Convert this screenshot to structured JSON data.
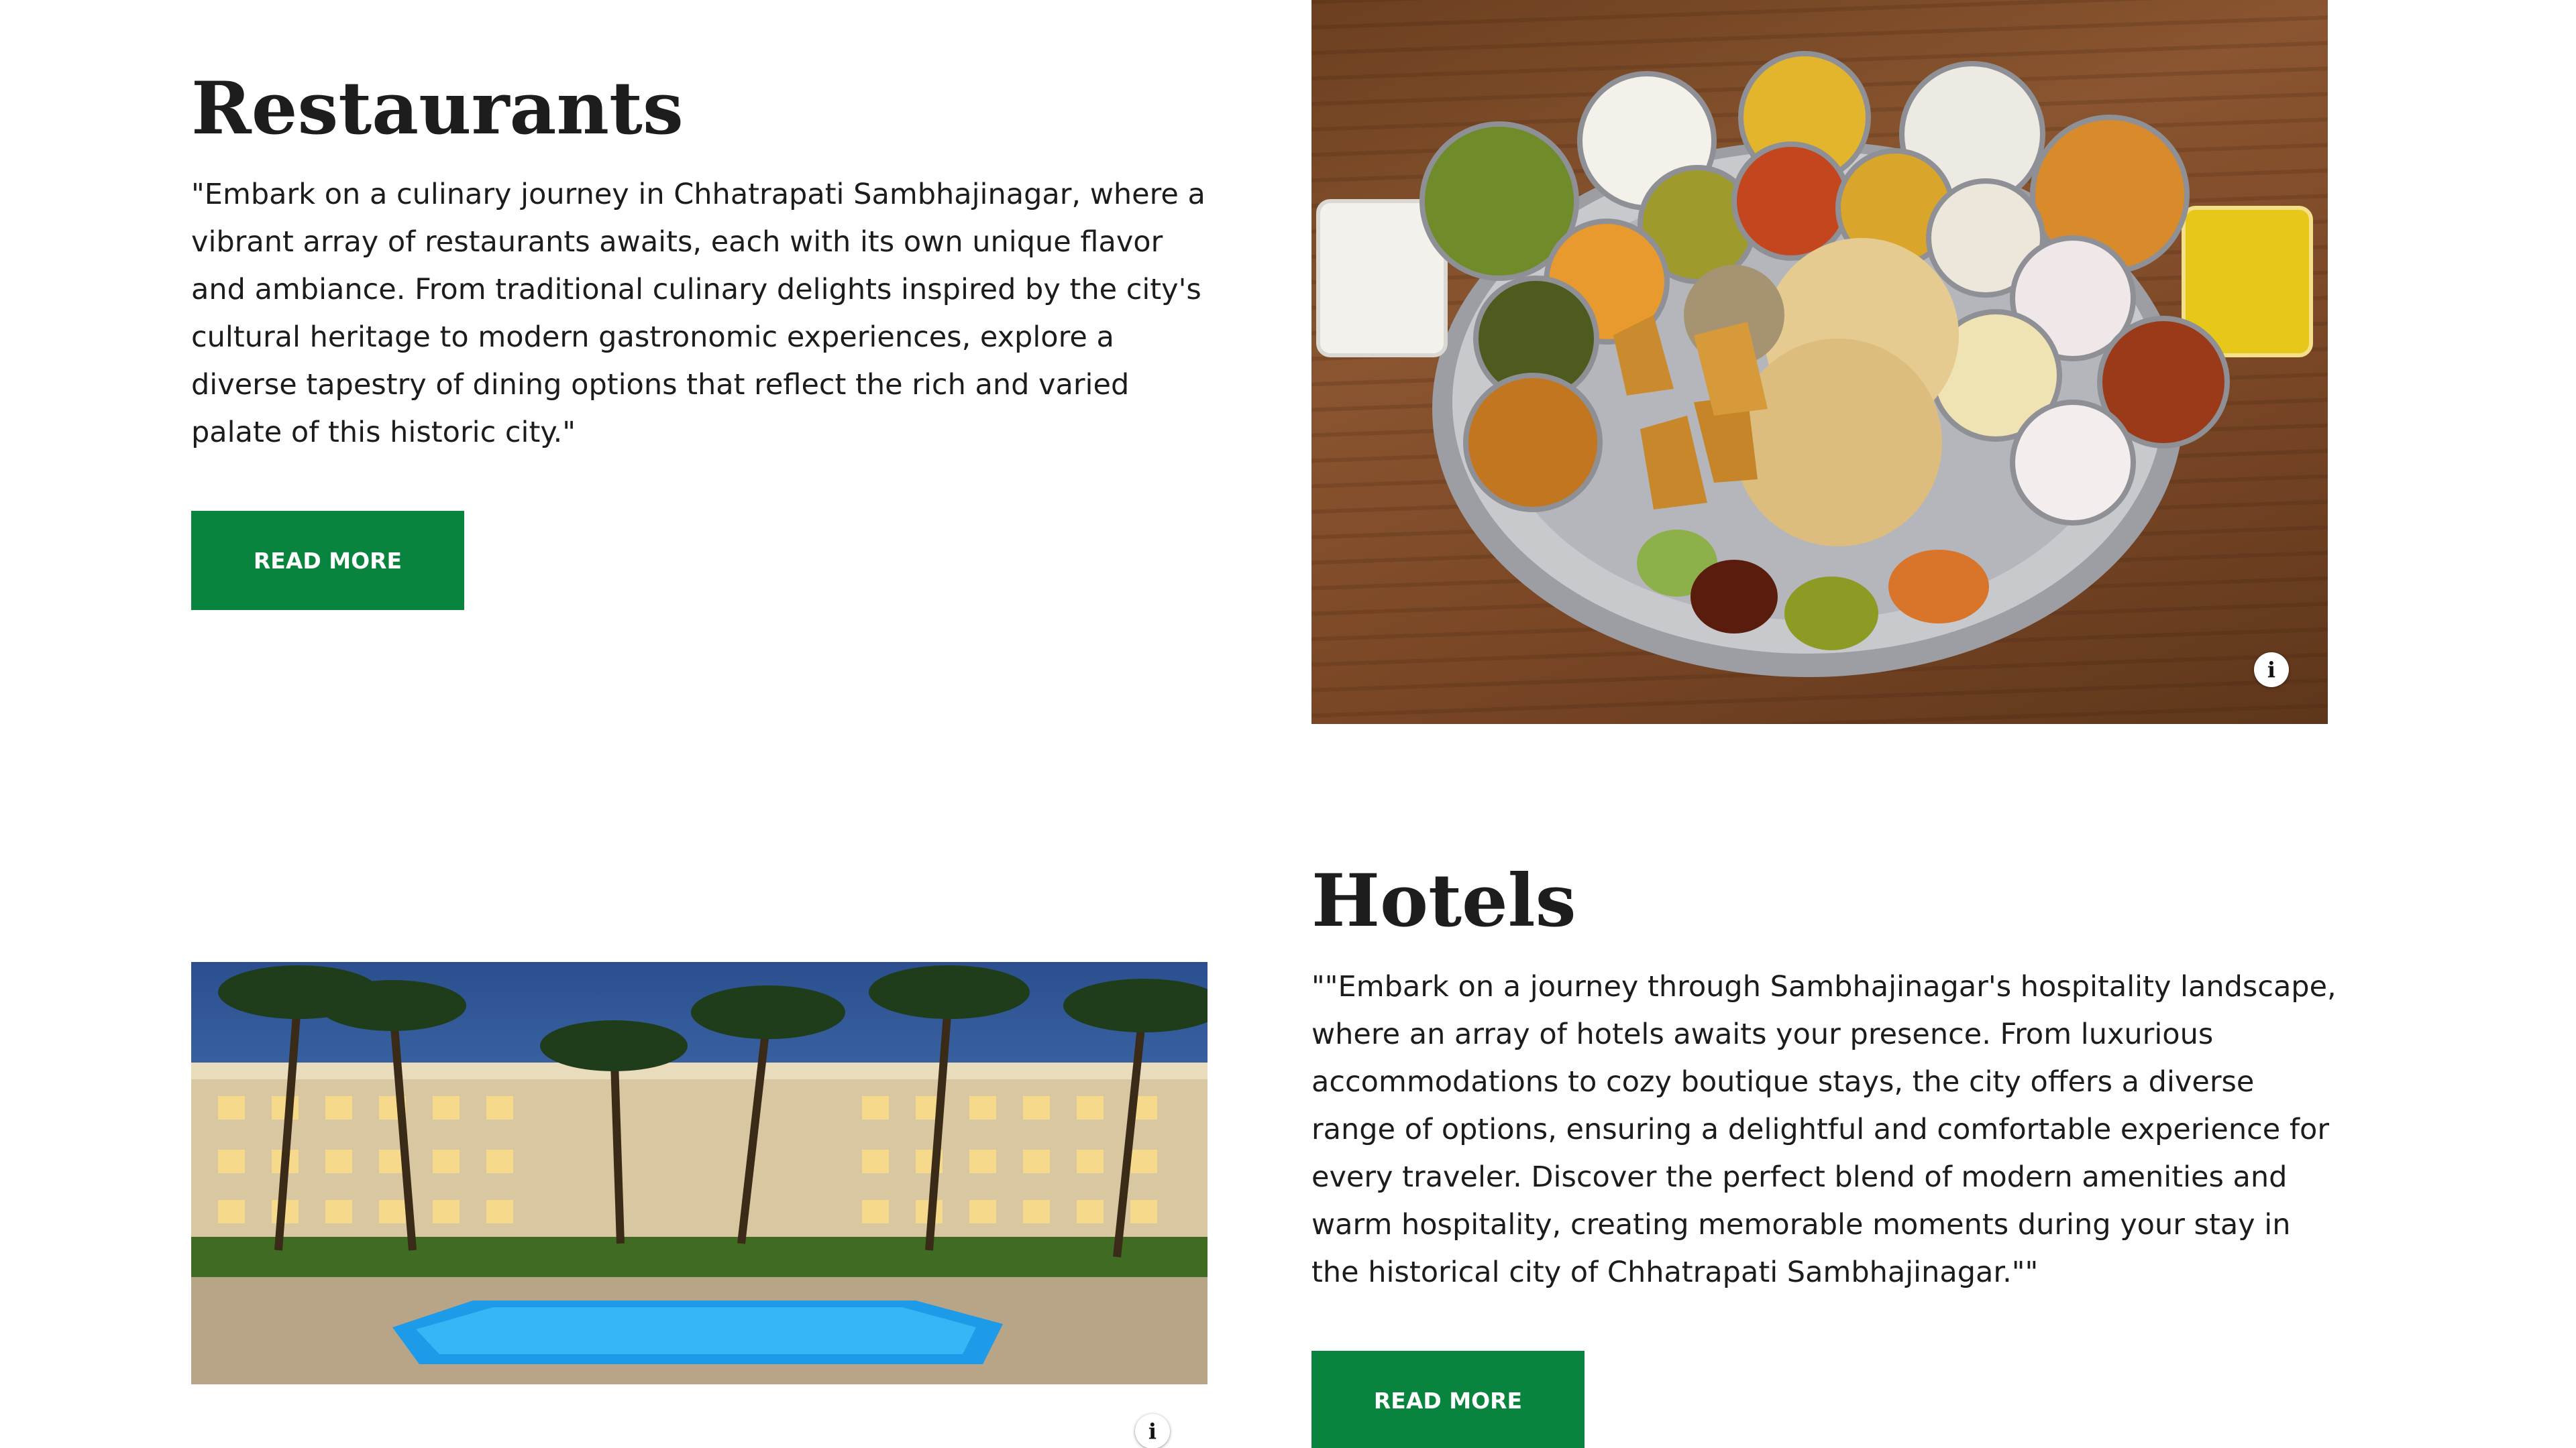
{
  "restaurants": {
    "title": "Restaurants",
    "description": "\"Embark on a culinary journey in Chhatrapati Sambhajinagar, where a vibrant array of restaurants awaits, each with its own unique flavor and ambiance. From traditional culinary delights inspired by the city's cultural heritage to modern gastronomic experiences, explore a diverse tapestry of dining options that reflect the rich and varied palate of this historic city.\"",
    "button_label": "READ MORE",
    "image_icon": "info-icon"
  },
  "hotels": {
    "title": "Hotels",
    "description": "\"\"Embark on a journey through Sambhajinagar's hospitality landscape, where an array of hotels awaits your presence. From luxurious accommodations to cozy boutique stays, the city offers a diverse range of options, ensuring a delightful and comfortable experience for every traveler. Discover the perfect blend of modern amenities and warm hospitality, creating memorable moments during your stay in the historical city of Chhatrapati Sambhajinagar.\"\"",
    "button_label": "READ MORE",
    "image_icon": "info-icon"
  },
  "colors": {
    "accent_green": "#09843e",
    "heading": "#1d1d1d",
    "body_text": "#1c1c1c",
    "background": "#ffffff"
  }
}
